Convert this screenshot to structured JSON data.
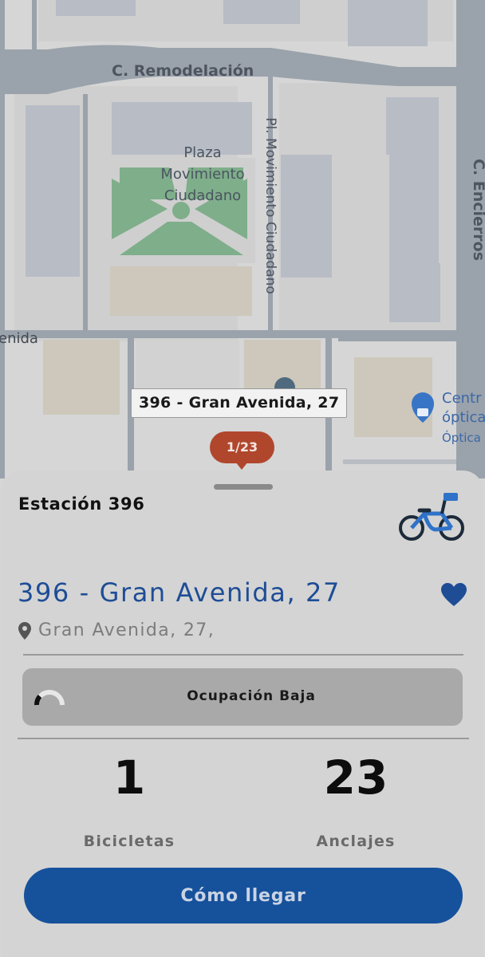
{
  "map": {
    "streets": {
      "remodelacion": "C. Remodelación",
      "plaza_movimiento": "Pl. Movimiento Ciudadano",
      "encierros": "C. Encierros",
      "avenida_partial": "enida"
    },
    "plaza_label": [
      "Plaza",
      "Movimiento",
      "Ciudadano"
    ],
    "poi": {
      "title_lines": [
        "Centr",
        "óptica"
      ],
      "subtitle": "Óptica"
    },
    "selected_station_tooltip": "396 - Gran Avenida, 27",
    "marker_label": "1/23",
    "colors": {
      "marker": "#b0472d",
      "park": "#7fae8a",
      "road": "#8e98a3"
    }
  },
  "sheet": {
    "station_number": "Estación 396",
    "station_name": "396 - Gran Avenida, 27",
    "address": "Gran Avenida, 27,",
    "occupancy": {
      "label": "Ocupación Baja"
    },
    "bikes": {
      "value": "1",
      "label": "Bicicletas"
    },
    "docks": {
      "value": "23",
      "label": "Anclajes"
    },
    "directions_button": "Cómo llegar",
    "icons": [
      "bike-icon",
      "heart-icon",
      "location-pin-icon",
      "gauge-icon"
    ],
    "colors": {
      "accent": "#16519c",
      "title": "#1e4d96"
    }
  }
}
